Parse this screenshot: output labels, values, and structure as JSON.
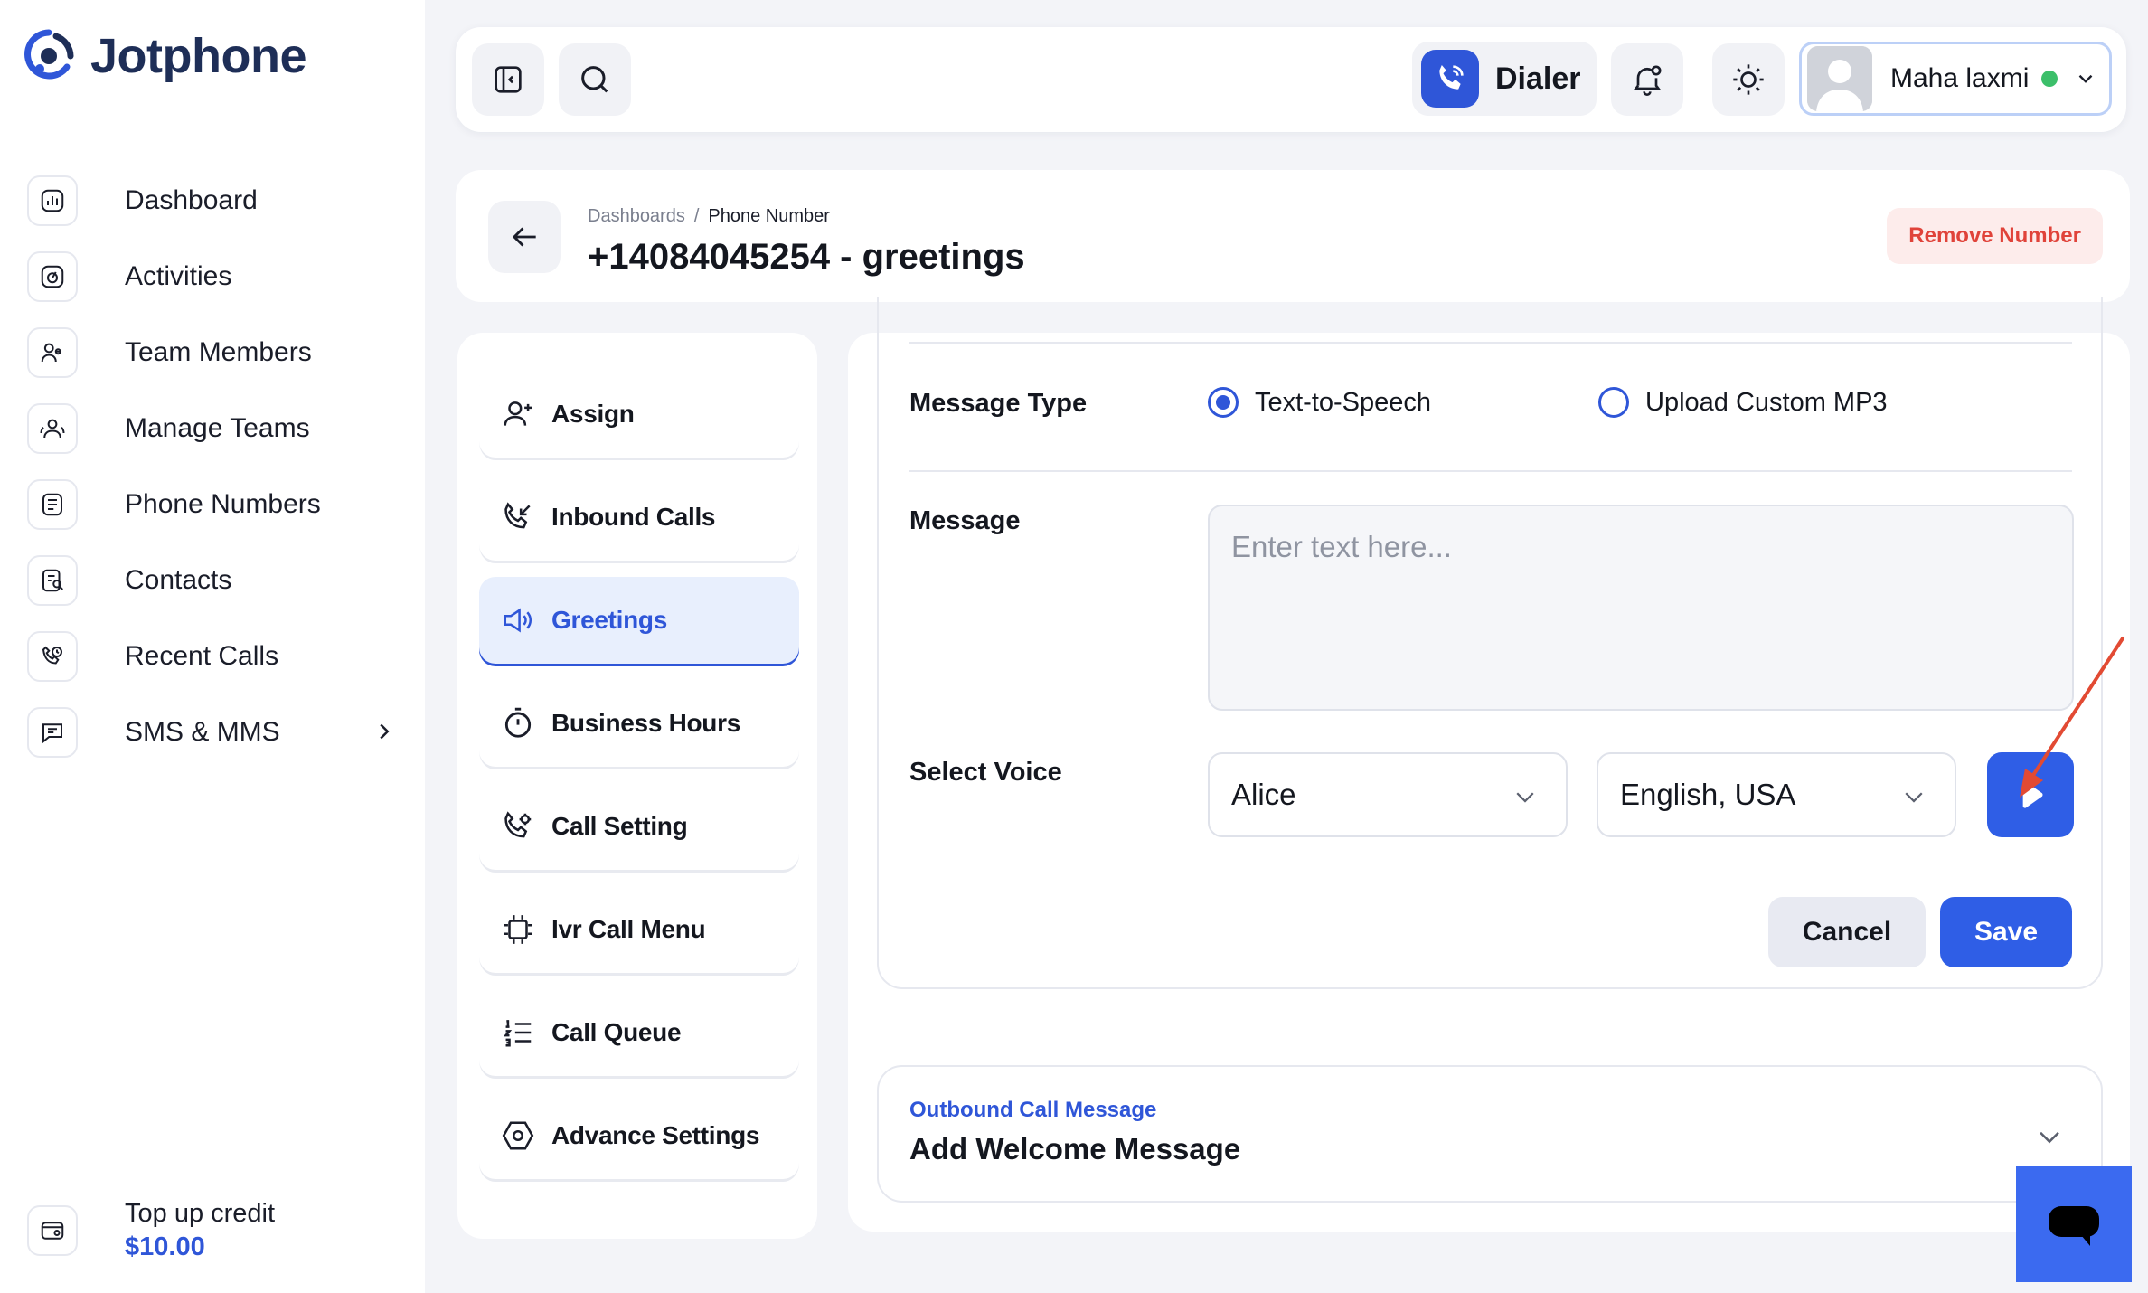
{
  "app": {
    "name": "Jotphone"
  },
  "sidebar": {
    "items": [
      {
        "label": "Dashboard",
        "icon": "chart-icon"
      },
      {
        "label": "Activities",
        "icon": "activity-icon"
      },
      {
        "label": "Team Members",
        "icon": "team-members-icon"
      },
      {
        "label": "Manage Teams",
        "icon": "manage-teams-icon"
      },
      {
        "label": "Phone Numbers",
        "icon": "phone-book-icon"
      },
      {
        "label": "Contacts",
        "icon": "contacts-icon"
      },
      {
        "label": "Recent Calls",
        "icon": "recent-calls-icon"
      },
      {
        "label": "SMS & MMS",
        "icon": "sms-icon"
      }
    ],
    "topup": {
      "label": "Top up credit",
      "value": "$10.00"
    }
  },
  "topbar": {
    "dialer_label": "Dialer",
    "user_name": "Maha laxmi",
    "status_color": "#3cbf6a"
  },
  "header": {
    "breadcrumb": [
      "Dashboards",
      "/",
      "Phone Number"
    ],
    "title": "+14084045254 - greetings",
    "remove_label": "Remove Number"
  },
  "settings_menu": {
    "items": [
      {
        "label": "Assign",
        "icon": "user-plus-icon"
      },
      {
        "label": "Inbound Calls",
        "icon": "inbound-call-icon"
      },
      {
        "label": "Greetings",
        "icon": "megaphone-icon",
        "active": true
      },
      {
        "label": "Business Hours",
        "icon": "timer-icon"
      },
      {
        "label": "Call Setting",
        "icon": "phone-settings-icon"
      },
      {
        "label": "Ivr Call Menu",
        "icon": "ivr-menu-icon"
      },
      {
        "label": "Call Queue",
        "icon": "list-ordered-icon"
      },
      {
        "label": "Advance Settings",
        "icon": "hexagon-settings-icon"
      }
    ]
  },
  "greeting_form": {
    "message_type_label": "Message Type",
    "options": [
      "Text-to-Speech",
      "Upload Custom MP3"
    ],
    "selected_option": "Text-to-Speech",
    "message_label": "Message",
    "message_placeholder": "Enter text here...",
    "select_voice_label": "Select Voice",
    "voice": "Alice",
    "language": "English, USA",
    "cancel_label": "Cancel",
    "save_label": "Save"
  },
  "outbound": {
    "subtitle": "Outbound Call Message",
    "title": "Add Welcome Message"
  },
  "colors": {
    "accent": "#2f56d8",
    "danger": "#e0433a",
    "annotation_arrow": "#e24a33"
  }
}
